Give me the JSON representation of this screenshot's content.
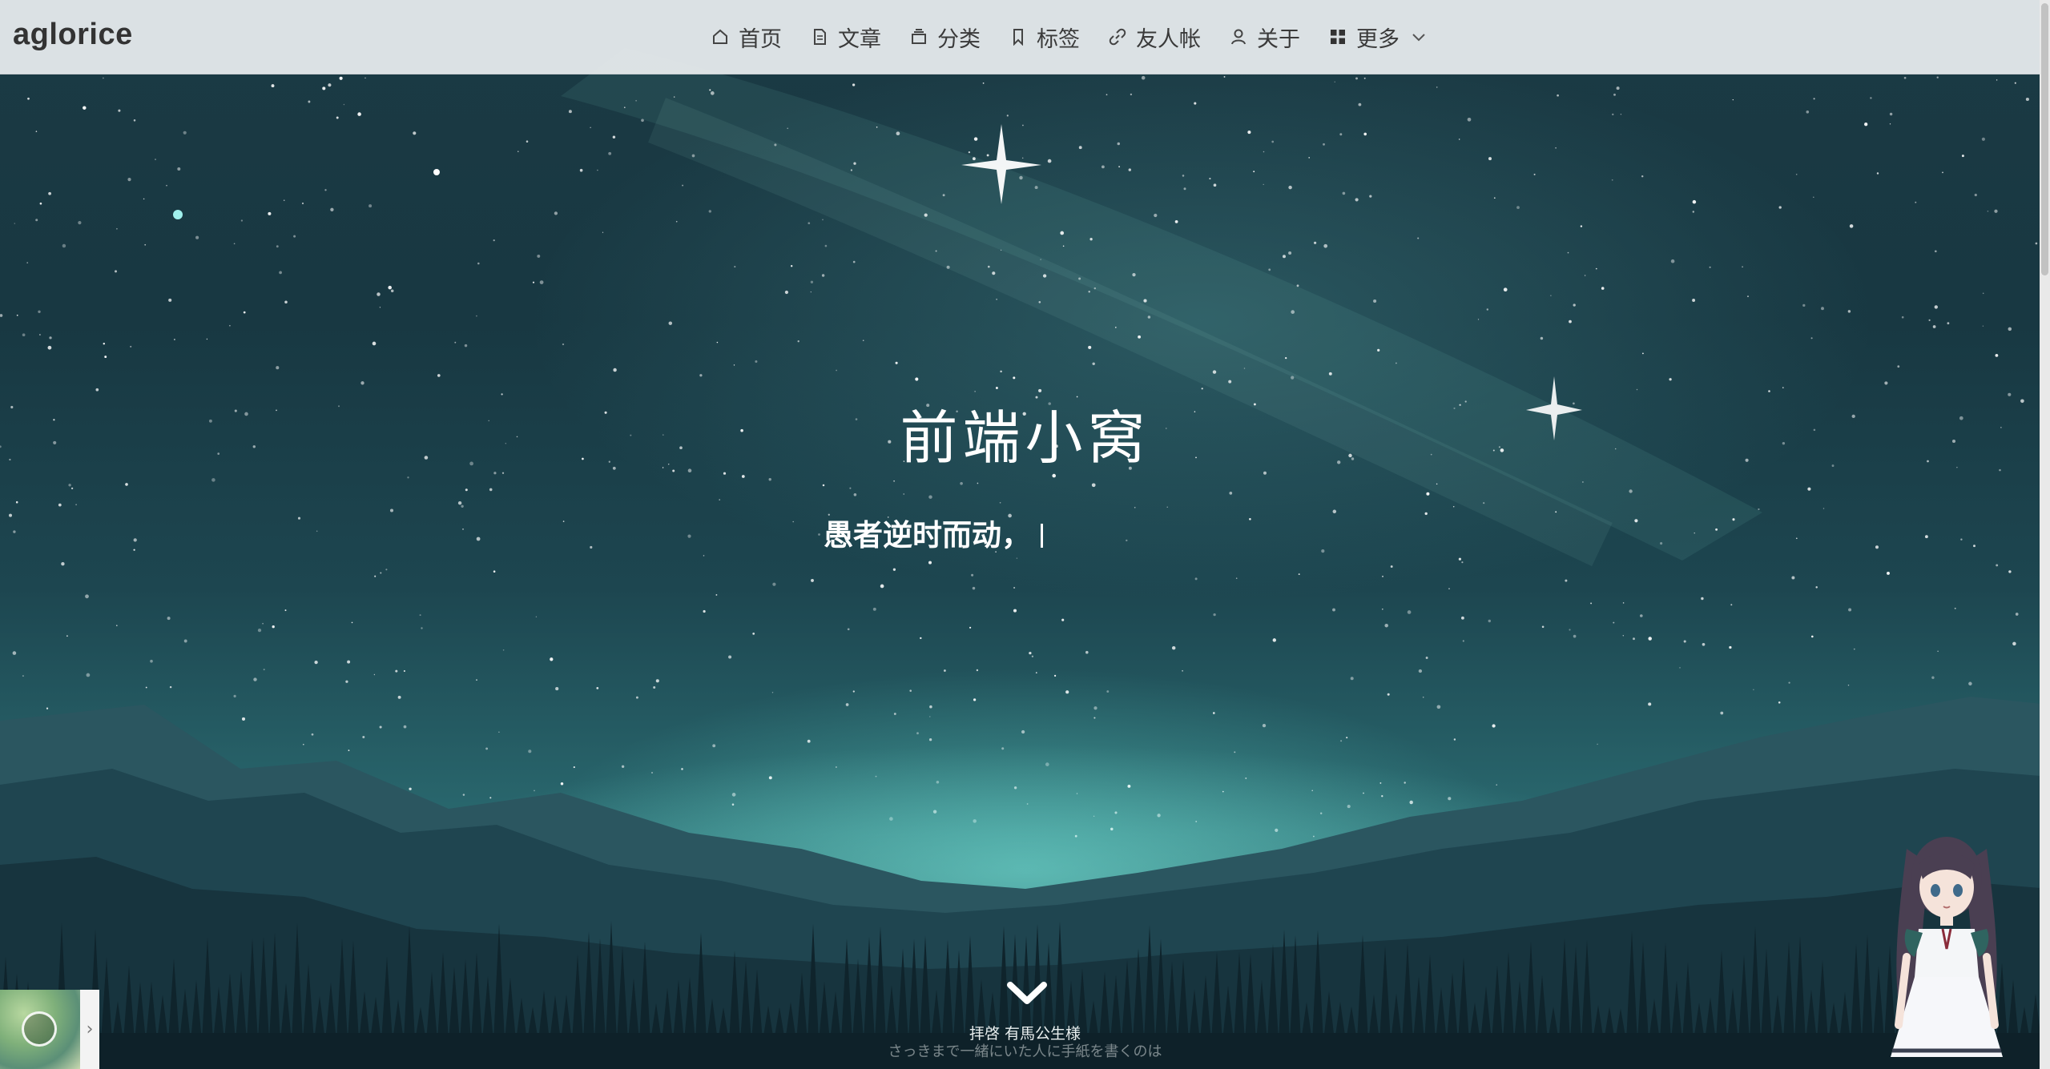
{
  "brand": "aglorice",
  "nav": {
    "items": [
      {
        "label": "首页",
        "icon": "home-icon"
      },
      {
        "label": "文章",
        "icon": "document-icon"
      },
      {
        "label": "分类",
        "icon": "folder-icon"
      },
      {
        "label": "标签",
        "icon": "bookmark-icon"
      },
      {
        "label": "友人帐",
        "icon": "link-icon"
      },
      {
        "label": "关于",
        "icon": "user-icon"
      },
      {
        "label": "更多",
        "icon": "grid-icon"
      }
    ]
  },
  "hero": {
    "title": "前端小窝",
    "subtitle": "愚者逆时而动，"
  },
  "music": {
    "title": "拝啓 有馬公生様",
    "lyric": "さっきまで一緒にいた人に手紙を書くのは"
  },
  "colors": {
    "nav_bg": "#e8ecee",
    "sky": "#1b3a44",
    "horizon_glow": "#5ac8be"
  }
}
